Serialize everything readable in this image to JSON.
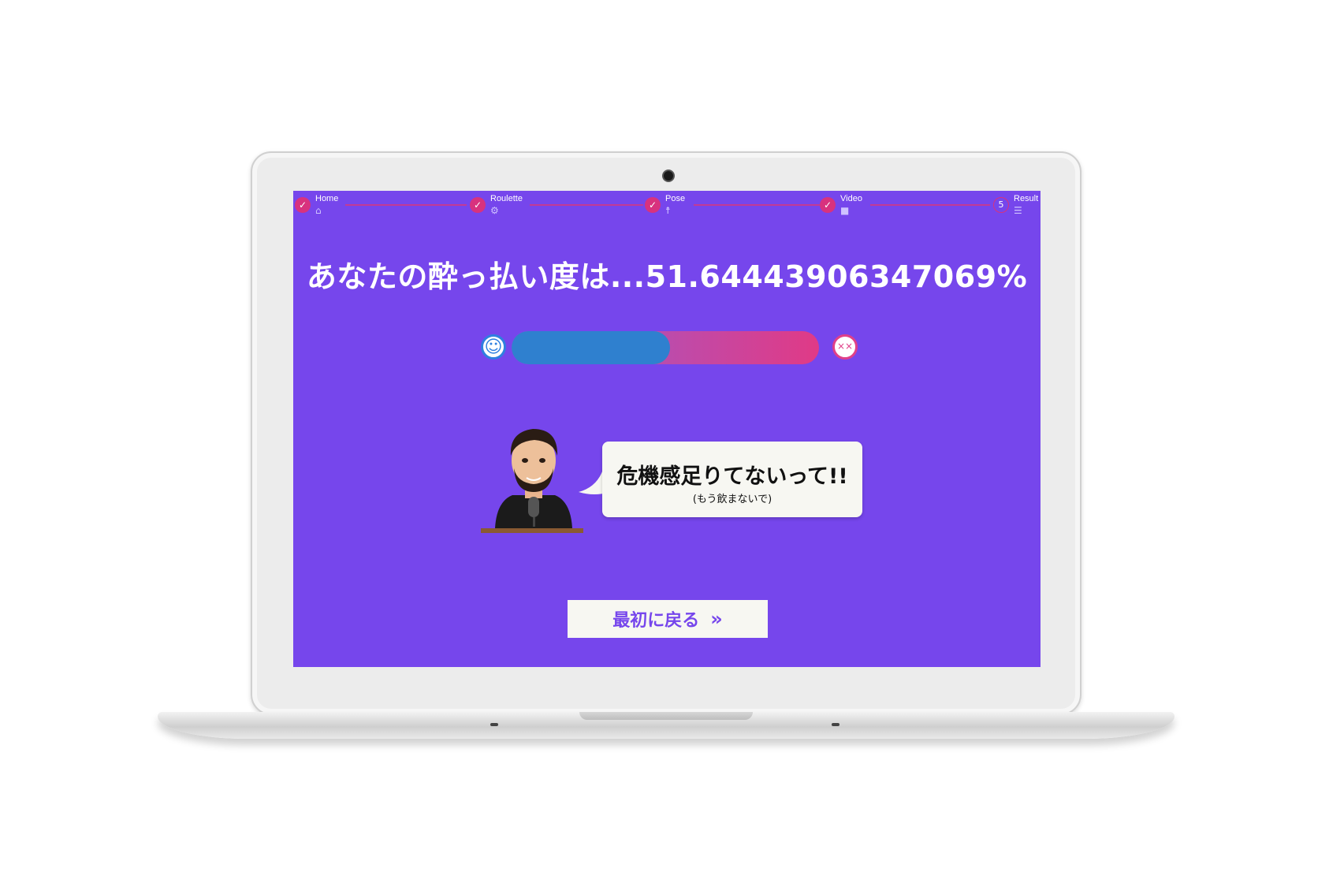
{
  "stepper": {
    "steps": [
      {
        "label": "Home",
        "status": "done",
        "icon": "home-icon"
      },
      {
        "label": "Roulette",
        "status": "done",
        "icon": "gear-icon"
      },
      {
        "label": "Pose",
        "status": "done",
        "icon": "person-icon"
      },
      {
        "label": "Video",
        "status": "done",
        "icon": "video-camera-icon"
      },
      {
        "label": "Result",
        "status": "current",
        "number": "5",
        "icon": "list-search-icon"
      }
    ],
    "check_glyph": "✓"
  },
  "result": {
    "headline": "あなたの酔っ払い度は...51.64443906347069%",
    "drunk_percent": 51.64443906347069
  },
  "meter": {
    "left_icon": "smiley-face-icon",
    "right_icon": "dizzy-face-icon"
  },
  "comment": {
    "main": "危機感足りてないって!!",
    "sub": "(もう飲まないで)"
  },
  "back_button": {
    "label": "最初に戻る",
    "icon": "double-chevron-right-icon"
  },
  "colors": {
    "screen_bg": "#7646ec",
    "accent_pink": "#d8327e",
    "meter_fill": "#2f80cf"
  }
}
